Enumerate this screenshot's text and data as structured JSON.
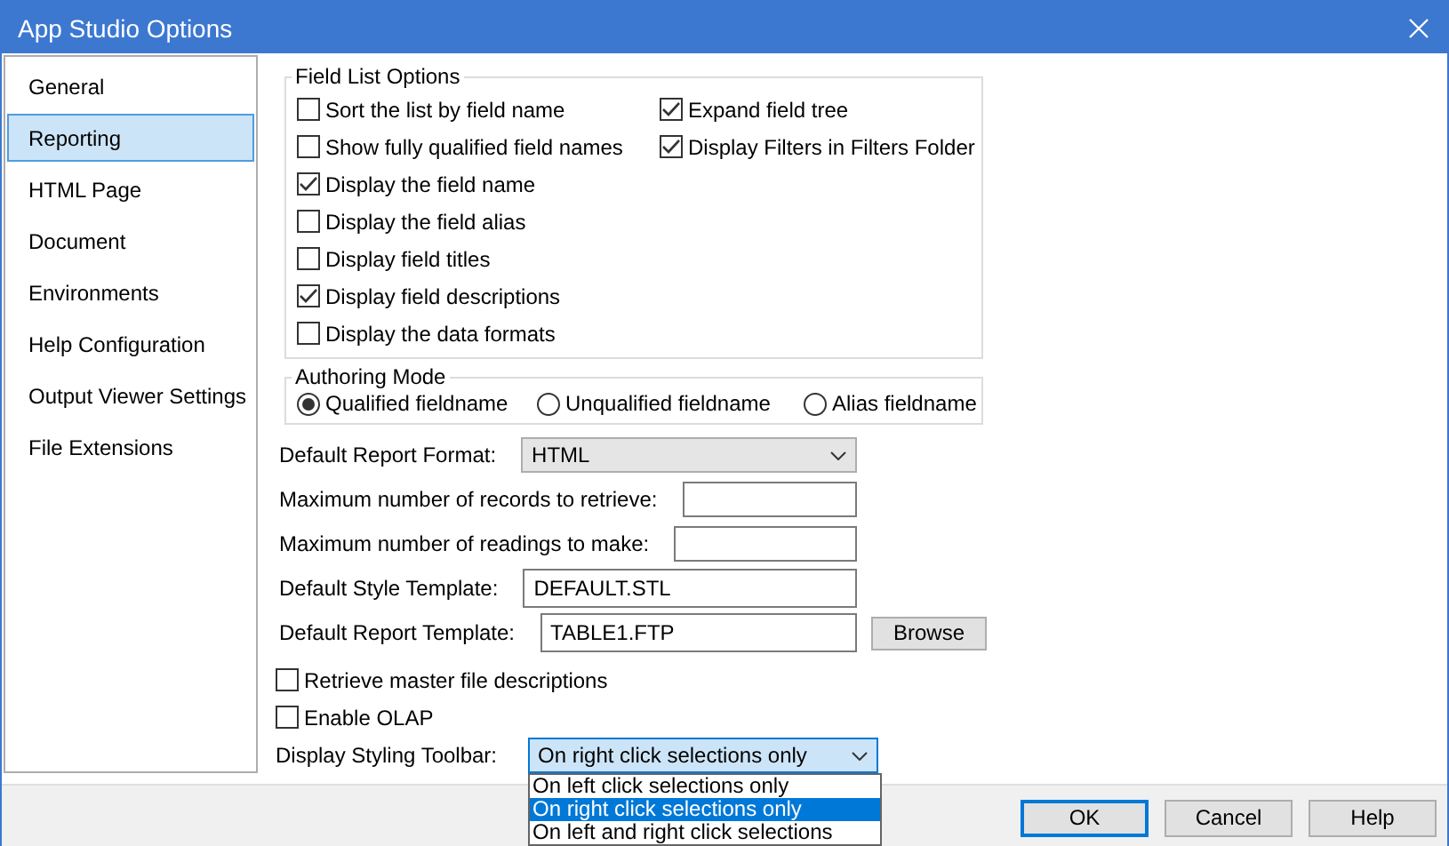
{
  "window": {
    "title": "App Studio Options"
  },
  "sidebar": {
    "items": [
      {
        "label": "General",
        "selected": false
      },
      {
        "label": "Reporting",
        "selected": true
      },
      {
        "label": "HTML Page",
        "selected": false
      },
      {
        "label": "Document",
        "selected": false
      },
      {
        "label": "Environments",
        "selected": false
      },
      {
        "label": "Help Configuration",
        "selected": false
      },
      {
        "label": "Output Viewer Settings",
        "selected": false
      },
      {
        "label": "File Extensions",
        "selected": false
      }
    ]
  },
  "field_list_options": {
    "title": "Field List Options",
    "left": [
      {
        "label": "Sort the list by field name",
        "checked": false
      },
      {
        "label": "Show fully qualified field names",
        "checked": false
      },
      {
        "label": "Display the field name",
        "checked": true
      },
      {
        "label": "Display the field alias",
        "checked": false
      },
      {
        "label": "Display field titles",
        "checked": false
      },
      {
        "label": "Display field descriptions",
        "checked": true
      },
      {
        "label": "Display the data formats",
        "checked": false
      }
    ],
    "right": [
      {
        "label": "Expand field tree",
        "checked": true
      },
      {
        "label": "Display Filters in Filters Folder",
        "checked": true
      }
    ]
  },
  "authoring_mode": {
    "title": "Authoring Mode",
    "options": [
      {
        "label": "Qualified fieldname",
        "selected": true
      },
      {
        "label": "Unqualified fieldname",
        "selected": false
      },
      {
        "label": "Alias fieldname",
        "selected": false
      }
    ]
  },
  "settings": [
    {
      "kind": "select",
      "label": "Default Report Format:",
      "value": "HTML"
    },
    {
      "kind": "input",
      "label": "Maximum number of records to retrieve:"
    },
    {
      "kind": "input",
      "label": "Maximum number of readings to make:"
    },
    {
      "kind": "input",
      "label": "Default Style Template:",
      "value": "DEFAULT.STL"
    },
    {
      "kind": "input",
      "label": "Default Report Template:",
      "value": "TABLE1.FTP",
      "button": "Browse"
    }
  ],
  "checkboxes": [
    {
      "label": "Retrieve master file descriptions",
      "checked": false
    },
    {
      "label": "Enable OLAP",
      "checked": false
    }
  ],
  "styling_toolbar": {
    "label": "Display Styling Toolbar:",
    "value": "On right click selections only",
    "expanded": true,
    "options": [
      {
        "label": "On left click selections only",
        "selected": false
      },
      {
        "label": "On right click selections only",
        "selected": true
      },
      {
        "label": "On left and right click selections",
        "selected": false
      }
    ]
  },
  "buttons": [
    {
      "label": "OK",
      "default": true
    },
    {
      "label": "Cancel",
      "default": false
    },
    {
      "label": "Help",
      "default": false
    }
  ]
}
